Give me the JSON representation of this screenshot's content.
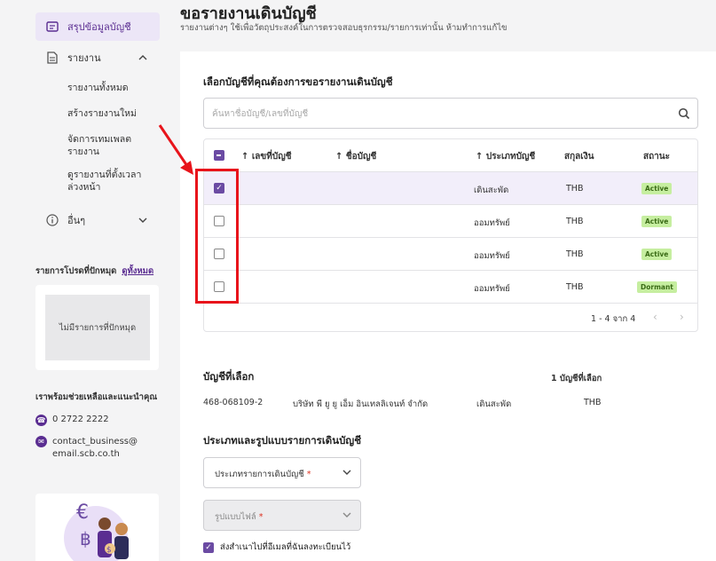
{
  "sidebar": {
    "active_item": "สรุปข้อมูลบัญชี",
    "reports": {
      "label": "รายงาน",
      "subitems": [
        "รายงานทั้งหมด",
        "สร้างรายงานใหม่",
        "จัดการเทมเพลตรายงาน",
        "ดูรายงานที่ตั้งเวลาล่วงหน้า"
      ]
    },
    "other": "อื่นๆ",
    "pinned_title": "รายการโปรดที่ปักหมุด",
    "pinned_link": "ดูทั้งหมด",
    "pinned_empty": "ไม่มีรายการที่ปักหมุด",
    "help_title": "เราพร้อมช่วยเหลือและแนะนำคุณ",
    "phone": "0 2722 2222",
    "email": "contact_business@email.scb.co.th"
  },
  "header": {
    "title": "ขอรายงานเดินบัญชี",
    "subtitle": "รายงานต่างๆ ใช้เพื่อวัตถุประสงค์ในการตรวจสอบธุรกรรม/รายการเท่านั้น ห้ามทำการแก้ไข"
  },
  "account_select": {
    "title": "เลือกบัญชีที่คุณต้องการขอรายงานเดินบัญชี",
    "search_placeholder": "ค้นหาชื่อบัญชี/เลขที่บัญชี",
    "columns": [
      "เลขที่บัญชี",
      "ชื่อบัญชี",
      "ประเภทบัญชี",
      "สกุลเงิน",
      "สถานะ"
    ],
    "rows": [
      {
        "type": "เดินสะพัด",
        "currency": "THB",
        "status": "Active",
        "checked": true
      },
      {
        "type": "ออมทรัพย์",
        "currency": "THB",
        "status": "Active",
        "checked": false
      },
      {
        "type": "ออมทรัพย์",
        "currency": "THB",
        "status": "Active",
        "checked": false
      },
      {
        "type": "ออมทรัพย์",
        "currency": "THB",
        "status": "Dormant",
        "checked": false
      }
    ],
    "pagination": "1 - 4 จาก 4"
  },
  "selected": {
    "title": "บัญชีที่เลือก",
    "count": "1 บัญชีที่เลือก",
    "account_no": "468-068109-2",
    "account_name": "บริษัท พี ยู ยู เอ็ม อินเทลลิเจนท์ จำกัด",
    "type": "เดินสะพัด",
    "currency": "THB"
  },
  "format": {
    "title": "ประเภทและรูปแบบรายการเดินบัญชี",
    "type_label": "ประเภทรายการเดินบัญชี",
    "file_label": "รูปแบบไฟล์",
    "required_mark": "*",
    "copy_label": "ส่งสำเนาไปที่อีเมลที่ฉันลงทะเบียนไว้"
  },
  "colors": {
    "accent": "#5a2d91",
    "annotation": "#e8141b",
    "active_badge": "#c6eea0"
  }
}
